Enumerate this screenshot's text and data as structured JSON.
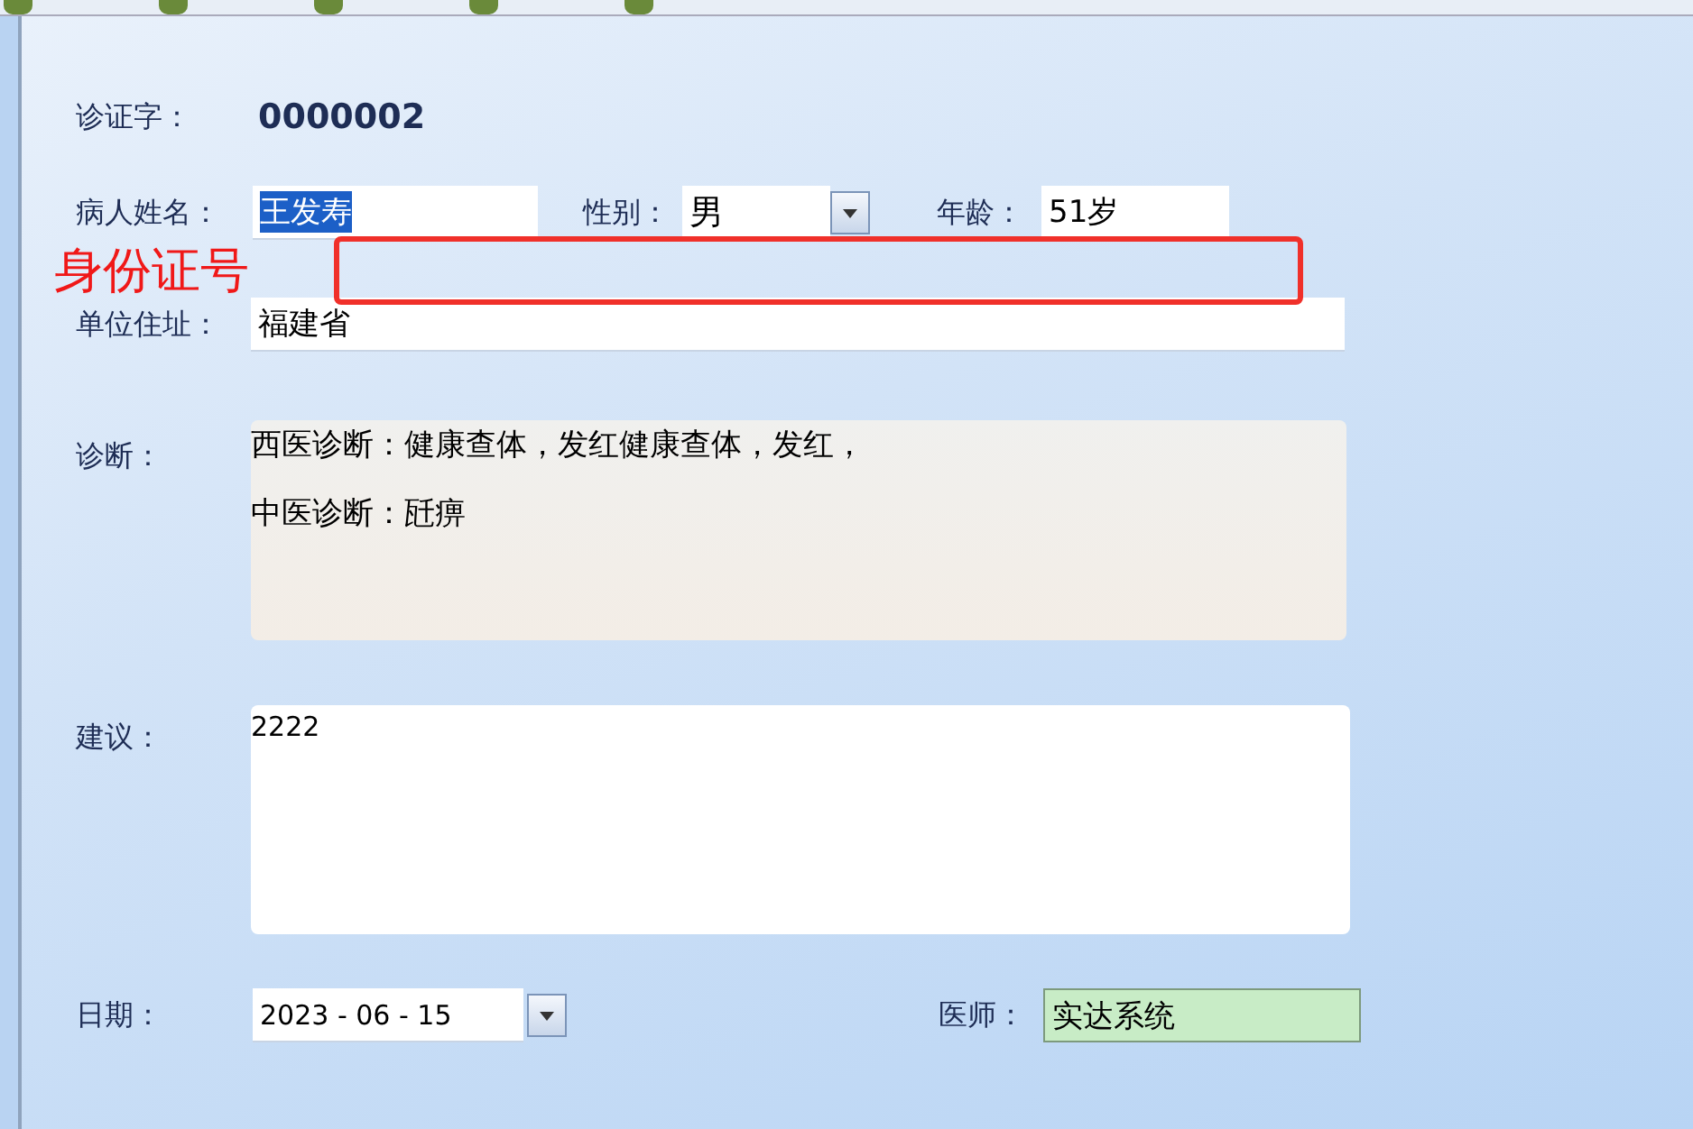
{
  "record_no": {
    "label": "诊证字：",
    "value": "0000002"
  },
  "patient": {
    "name_label": "病人姓名：",
    "name": "王发寿",
    "name_selected": true,
    "sex_label": "性别：",
    "sex": "男",
    "age_label": "年龄：",
    "age": "51岁"
  },
  "annotation": {
    "text": "身份证号"
  },
  "address": {
    "label": "单位住址：",
    "value": "福建省"
  },
  "diagnosis": {
    "label": "诊断：",
    "lines": [
      "西医诊断：健康查体，发红健康查体，发红，",
      "中医诊断：瓩痹"
    ]
  },
  "advice": {
    "label": "建议：",
    "value": "2222"
  },
  "date": {
    "label": "日期：",
    "value": "2023 - 06 - 15"
  },
  "doctor": {
    "label": "医师：",
    "value": "实达系统"
  }
}
